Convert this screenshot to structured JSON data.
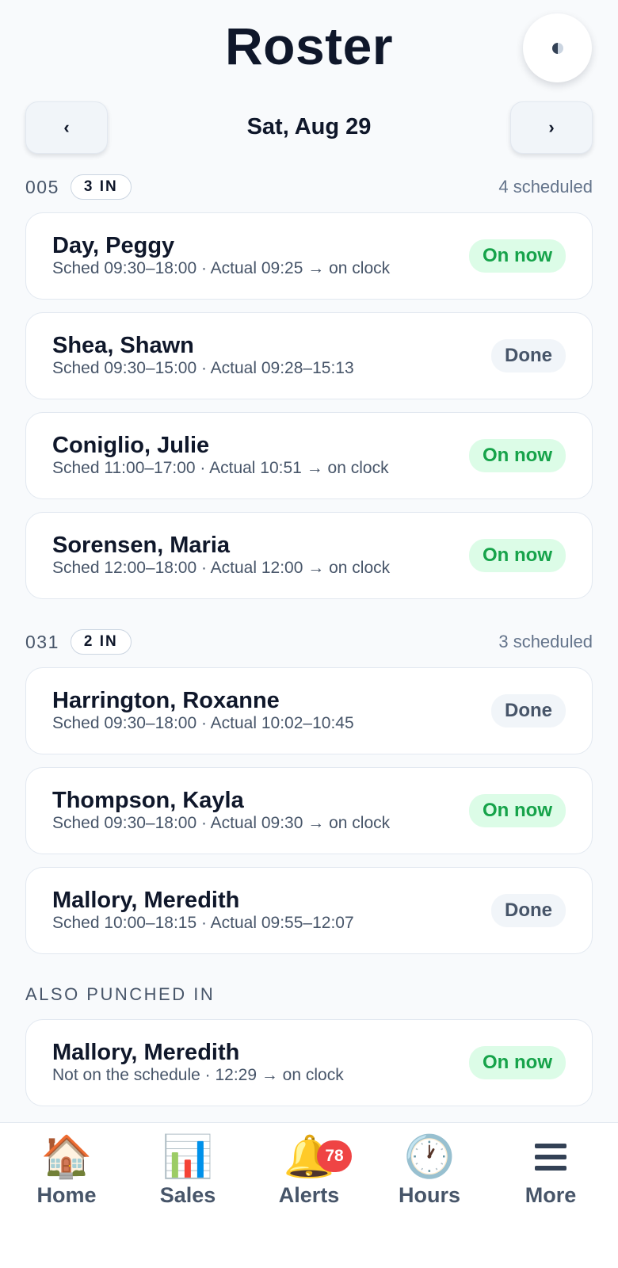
{
  "header": {
    "title": "Roster",
    "theme_icon": "half-moon-icon"
  },
  "date_nav": {
    "prev_label": "‹",
    "next_label": "›",
    "date": "Sat, Aug 29"
  },
  "groups": [
    {
      "store": "005",
      "in_count": "3 IN",
      "scheduled": "4 scheduled",
      "shifts": [
        {
          "name": "Day, Peggy",
          "detail": "Sched 09:30–18:00 · Actual 09:25 → on clock",
          "status": "On now"
        },
        {
          "name": "Shea, Shawn",
          "detail": "Sched 09:30–15:00 · Actual 09:28–15:13",
          "status": "Done"
        },
        {
          "name": "Coniglio, Julie",
          "detail": "Sched 11:00–17:00 · Actual 10:51 → on clock",
          "status": "On now"
        },
        {
          "name": "Sorensen, Maria",
          "detail": "Sched 12:00–18:00 · Actual 12:00 → on clock",
          "status": "On now"
        }
      ]
    },
    {
      "store": "031",
      "in_count": "2 IN",
      "scheduled": "3 scheduled",
      "shifts": [
        {
          "name": "Harrington, Roxanne",
          "detail": "Sched 09:30–18:00 · Actual 10:02–10:45",
          "status": "Done"
        },
        {
          "name": "Thompson, Kayla",
          "detail": "Sched 09:30–18:00 · Actual 09:30 → on clock",
          "status": "On now"
        },
        {
          "name": "Mallory, Meredith",
          "detail": "Sched 10:00–18:15 · Actual 09:55–12:07",
          "status": "Done"
        }
      ]
    }
  ],
  "also_punched": {
    "title": "ALSO PUNCHED IN",
    "shifts": [
      {
        "name": "Mallory, Meredith",
        "detail": "Not on the schedule · 12:29 → on clock",
        "status": "On now"
      }
    ]
  },
  "bottom_nav": {
    "items": [
      {
        "label": "Home",
        "icon": "🏠"
      },
      {
        "label": "Sales",
        "icon": "📊"
      },
      {
        "label": "Alerts",
        "icon": "🔔",
        "badge": "78"
      },
      {
        "label": "Hours",
        "icon": "🕐"
      },
      {
        "label": "More",
        "icon": "menu-icon"
      }
    ]
  },
  "colors": {
    "on_now": "#16a34a",
    "on_now_bg": "#dcfce7",
    "badge": "#ef4444"
  }
}
